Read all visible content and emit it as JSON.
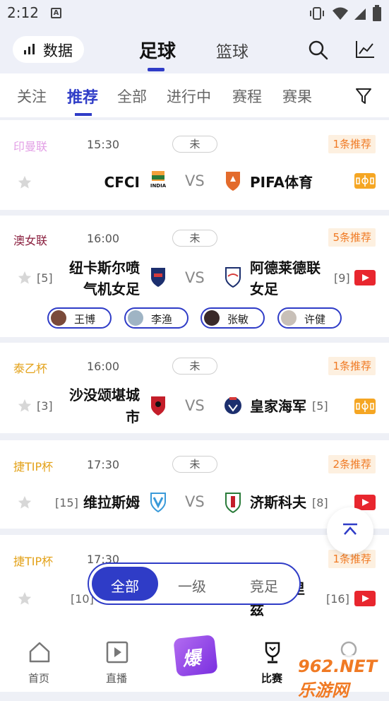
{
  "status_bar": {
    "time": "2:12"
  },
  "header": {
    "data_button": "数据",
    "tabs": [
      "足球",
      "篮球"
    ],
    "active_tab": "足球"
  },
  "subtabs": [
    "关注",
    "推荐",
    "全部",
    "进行中",
    "赛程",
    "赛果"
  ],
  "active_subtab": "推荐",
  "matches": [
    {
      "league": "印曼联",
      "league_color": "#e3a0e6",
      "time": "15:30",
      "status": "未",
      "rec": "1条推荐",
      "home": "CFCI",
      "home_rank": "",
      "away": "PIFA体育",
      "away_rank": "",
      "media": "field",
      "home_logo_text": "INDIA"
    },
    {
      "league": "澳女联",
      "league_color": "#8a1f3e",
      "time": "16:00",
      "status": "未",
      "rec": "5条推荐",
      "home": "纽卡斯尔喷气机女足",
      "home_lines": [
        "纽卡斯尔喷",
        "气机女足"
      ],
      "home_rank": "[5]",
      "away": "阿德莱德联女足",
      "away_lines": [
        "阿德莱德联",
        "女足"
      ],
      "away_rank": "[9]",
      "media": "video",
      "experts": [
        "王博",
        "李渔",
        "张敏",
        "许健"
      ]
    },
    {
      "league": "泰乙杯",
      "league_color": "#e3a21a",
      "time": "16:00",
      "status": "未",
      "rec": "1条推荐",
      "home": "沙没颂堪城市",
      "home_lines": [
        "沙没颂堪城",
        "市"
      ],
      "home_rank": "[3]",
      "away": "皇家海军",
      "away_rank": "[5]",
      "media": "field"
    },
    {
      "league": "捷TIP杯",
      "league_color": "#e3a21a",
      "time": "17:30",
      "status": "未",
      "rec": "2条推荐",
      "home": "维拉斯姆",
      "home_rank": "[15]",
      "away": "济斯科夫",
      "away_rank": "[8]",
      "media": "video"
    },
    {
      "league": "捷TIP杯",
      "league_color": "#e3a21a",
      "time": "17:30",
      "status": "未",
      "rec": "1条推荐",
      "home_rank": "[10]",
      "away_partial": [
        "里",
        "兹"
      ],
      "away_rank": "[16]",
      "media": "video"
    }
  ],
  "filter_pill": {
    "options": [
      "全部",
      "一级",
      "竞足"
    ],
    "active": "全部"
  },
  "bottom_nav": {
    "items": [
      "首页",
      "直播",
      "比赛"
    ],
    "active": "比赛"
  },
  "watermark": "962.NET 乐游网"
}
